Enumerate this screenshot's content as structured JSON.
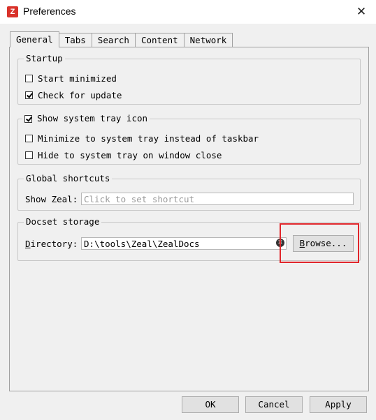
{
  "window": {
    "title": "Preferences",
    "close_icon": "close-icon",
    "app_icon": "zeal-app-icon",
    "app_icon_glyph": "Z"
  },
  "tabs": [
    {
      "label": "General",
      "active": true
    },
    {
      "label": "Tabs",
      "active": false
    },
    {
      "label": "Search",
      "active": false
    },
    {
      "label": "Content",
      "active": false
    },
    {
      "label": "Network",
      "active": false
    }
  ],
  "startup": {
    "title": "Startup",
    "start_minimized": {
      "label": "Start minimized",
      "checked": false
    },
    "check_for_update": {
      "label": "Check for update",
      "checked": true
    }
  },
  "tray": {
    "title": "Show system tray icon",
    "checked": true,
    "minimize_to_tray": {
      "label": "Minimize to system tray instead of taskbar",
      "checked": false
    },
    "hide_on_close": {
      "label": "Hide to system tray on window close",
      "checked": false
    }
  },
  "shortcuts": {
    "title": "Global shortcuts",
    "show_zeal_label": "Show Zeal:",
    "placeholder": "Click to set shortcut",
    "value": ""
  },
  "docset": {
    "title": "Docset storage",
    "directory_label_underlined": "D",
    "directory_label_rest": "irectory:",
    "directory_value": "D:\\tools\\Zeal\\ZealDocs",
    "browse_underlined": "B",
    "browse_rest": "rowse..."
  },
  "footer": {
    "ok": "OK",
    "cancel": "Cancel",
    "apply": "Apply"
  },
  "colors": {
    "highlight": "#e0262b",
    "app_icon": "#d9322a"
  }
}
